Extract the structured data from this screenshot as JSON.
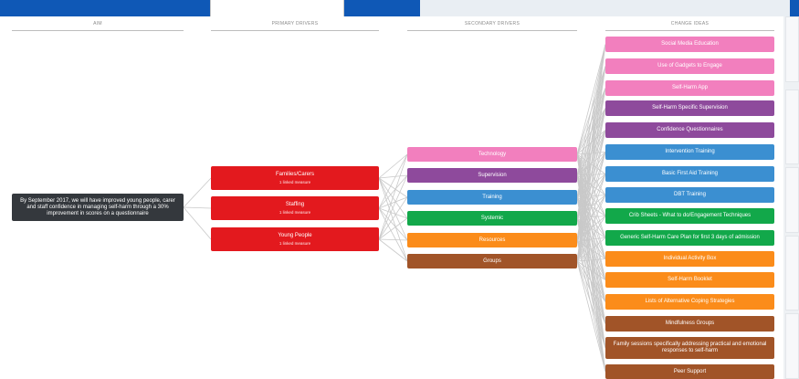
{
  "columns": {
    "aim": "AIM",
    "primary": "PRIMARY DRIVERS",
    "secondary": "SECONDARY DRIVERS",
    "change": "CHANGE IDEAS"
  },
  "aim": {
    "text": "By September 2017, we will have improved young people, carer and staff confidence in managing self-harm through a 30% improvement in scores on a questionnaire"
  },
  "primary_drivers": [
    {
      "label": "Families/Carers",
      "measure": "1 linked measure"
    },
    {
      "label": "Staffing",
      "measure": "1 linked measure"
    },
    {
      "label": "Young People",
      "measure": "1 linked measure"
    }
  ],
  "secondary_drivers": [
    {
      "label": "Technology",
      "color": "#f27fbe"
    },
    {
      "label": "Supervision",
      "color": "#8e4a9c"
    },
    {
      "label": "Training",
      "color": "#3b8fd1"
    },
    {
      "label": "Systemic",
      "color": "#12a84a"
    },
    {
      "label": "Resources",
      "color": "#fb8c1a"
    },
    {
      "label": "Groups",
      "color": "#a15428"
    }
  ],
  "change_ideas": [
    {
      "label": "Social Media Education",
      "color": "#f27fbe"
    },
    {
      "label": "Use of Gadgets to Engage",
      "color": "#f27fbe"
    },
    {
      "label": "Self-Harm App",
      "color": "#f27fbe"
    },
    {
      "label": "Self-Harm Specific Supervision",
      "color": "#8e4a9c"
    },
    {
      "label": "Confidence Questionnaires",
      "color": "#8e4a9c"
    },
    {
      "label": "Intervention Training",
      "color": "#3b8fd1"
    },
    {
      "label": "Basic First Aid Training",
      "color": "#3b8fd1"
    },
    {
      "label": "DBT Training",
      "color": "#3b8fd1"
    },
    {
      "label": "Crib Sheets - What to do/Engagement Techniques",
      "color": "#12a84a"
    },
    {
      "label": "Generic Self-Harm Care Plan for first 3 days of admission",
      "color": "#12a84a"
    },
    {
      "label": "Individual Activity Box",
      "color": "#fb8c1a"
    },
    {
      "label": "Self-Harm Booklet",
      "color": "#fb8c1a"
    },
    {
      "label": "Lists of Alternative Coping Strategies",
      "color": "#fb8c1a"
    },
    {
      "label": "Mindfulness Groups",
      "color": "#a15428"
    },
    {
      "label": "Family sessions specifically addressing practical and emotional responses to self-harm",
      "color": "#a15428"
    },
    {
      "label": "Peer Support",
      "color": "#a15428"
    }
  ],
  "colors": {
    "primary_driver": "#e3191e",
    "aim": "#34383d",
    "link": "#c9c9c9",
    "header_bar": "#0f58b6"
  }
}
